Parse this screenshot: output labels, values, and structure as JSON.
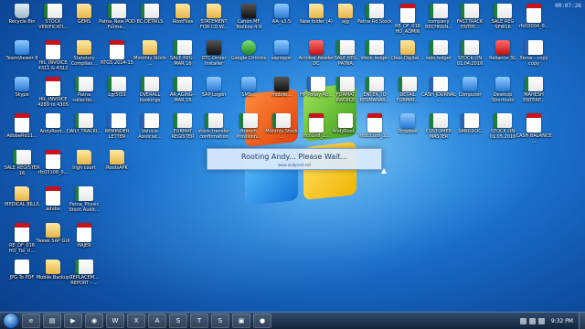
{
  "desktop_icons": [
    {
      "label": "Recycle Bin",
      "icon": "recycle-bin-icon",
      "kind": "g-bin"
    },
    {
      "label": "TeamViewer 8",
      "icon": "teamviewer-icon",
      "kind": "g-blue"
    },
    {
      "label": "Skype",
      "icon": "skype-icon",
      "kind": "g-blue"
    },
    {
      "label": "AdobeRd11...",
      "icon": "pdf-file-icon",
      "kind": "g-pdf"
    },
    {
      "label": "SALE REGISTER 16",
      "icon": "excel-file-icon",
      "kind": "g-excel"
    },
    {
      "label": "MEDICAL BILLS",
      "icon": "folder-icon",
      "kind": "g-folder"
    },
    {
      "label": "RE_DF_016 HO_Tie_U...",
      "icon": "pdf-file-icon",
      "kind": "g-pdf"
    },
    {
      "label": "JPG To PDF",
      "icon": "image-file-icon",
      "kind": "g-doc"
    },
    {
      "label": "STOCK VERIFICATI...",
      "icon": "excel-file-icon",
      "kind": "g-excel"
    },
    {
      "label": "HIL_INVOICE 4311 & 4312",
      "icon": "pdf-file-icon",
      "kind": "g-pdf"
    },
    {
      "label": "HIL_INVOICE 4289 to 4305",
      "icon": "pdf-file-icon",
      "kind": "g-pdf"
    },
    {
      "label": "AndyRoot...",
      "icon": "archive-file-icon",
      "kind": "g-doc"
    },
    {
      "label": "rfc03108_0...",
      "icon": "pdf-file-icon",
      "kind": "g-pdf"
    },
    {
      "label": "adobe",
      "icon": "pdf-file-icon",
      "kind": "g-pdf"
    },
    {
      "label": "Tweak SAP GUI",
      "icon": "folder-icon",
      "kind": "g-folder"
    },
    {
      "label": "Mobile Backup",
      "icon": "folder-icon",
      "kind": "g-folder"
    },
    {
      "label": "GEMS",
      "icon": "folder-icon",
      "kind": "g-folder"
    },
    {
      "label": "Statutory Complian...",
      "icon": "folder-icon",
      "kind": "g-folder"
    },
    {
      "label": "Patna collectio...",
      "icon": "excel-file-icon",
      "kind": "g-excel"
    },
    {
      "label": "DAILY TRACKI...",
      "icon": "excel-file-icon",
      "kind": "g-excel"
    },
    {
      "label": "high court",
      "icon": "folder-icon",
      "kind": "g-folder"
    },
    {
      "label": "Patna_Physic Stock Audit...",
      "icon": "excel-file-icon",
      "kind": "g-excel"
    },
    {
      "label": "HAJER",
      "icon": "pdf-file-icon",
      "kind": "g-pdf"
    },
    {
      "label": "REPLACEM... REPORT - ...",
      "icon": "excel-file-icon",
      "kind": "g-excel"
    },
    {
      "label": "Patna_New POD Forma...",
      "icon": "excel-file-icon",
      "kind": "g-excel"
    },
    {
      "label": "BC DETAILS",
      "icon": "excel-file-icon",
      "kind": "g-excel"
    },
    {
      "label": "RootFiles",
      "icon": "folder-icon",
      "kind": "g-folder"
    },
    {
      "label": "STATEMENT FOR CD W...",
      "icon": "folder-icon",
      "kind": "g-folder"
    },
    {
      "label": "Canon MF Toolbox 4.9",
      "icon": "printer-icon",
      "kind": "g-dark"
    },
    {
      "label": "AA_v3.5",
      "icon": "app-icon",
      "kind": "g-blue"
    },
    {
      "label": "New folder (4)",
      "icon": "folder-icon",
      "kind": "g-folder"
    },
    {
      "label": "ajg",
      "icon": "folder-icon",
      "kind": "g-folder"
    },
    {
      "label": "Patna Rd Stock",
      "icon": "excel-file-icon",
      "kind": "g-excel"
    },
    {
      "label": "RE_DF_016 HO_ADMIN",
      "icon": "pdf-file-icon",
      "kind": "g-pdf"
    },
    {
      "label": "company RECHNUN...",
      "icon": "excel-file-icon",
      "kind": "g-excel"
    },
    {
      "label": "FASTTRACK ENTRY...",
      "icon": "excel-file-icon",
      "kind": "g-excel"
    },
    {
      "label": "SALE REG SPW16",
      "icon": "excel-file-icon",
      "kind": "g-excel"
    },
    {
      "label": "rfc03004_0...",
      "icon": "pdf-file-icon",
      "kind": "g-pdf"
    },
    {
      "label": "RTGS 2014-15",
      "icon": "pdf-file-icon",
      "kind": "g-pdf"
    },
    {
      "label": "Monthly Stock ...",
      "icon": "folder-icon",
      "kind": "g-folder"
    },
    {
      "label": "SALE REG - MAR 16",
      "icon": "excel-file-icon",
      "kind": "g-excel"
    },
    {
      "label": "DTC Driver Installer",
      "icon": "app-icon",
      "kind": "g-dark"
    },
    {
      "label": "Google Chrome",
      "icon": "chrome-icon",
      "kind": "g-green"
    },
    {
      "label": "saplogon",
      "icon": "sap-icon",
      "kind": "g-blue"
    },
    {
      "label": "Acrobat Reader DC",
      "icon": "acrobat-icon",
      "kind": "g-red"
    },
    {
      "label": "SALE REG PATNA",
      "icon": "excel-file-icon",
      "kind": "g-excel"
    },
    {
      "label": "stock ledger",
      "icon": "excel-file-icon",
      "kind": "g-excel"
    },
    {
      "label": "Clear Digital ...",
      "icon": "folder-icon",
      "kind": "g-folder"
    },
    {
      "label": "sale ledger",
      "icon": "excel-file-icon",
      "kind": "g-excel"
    },
    {
      "label": "STOCK ON 01.04.2016",
      "icon": "excel-file-icon",
      "kind": "g-excel"
    },
    {
      "label": "Reliance 3G",
      "icon": "app-icon",
      "kind": "g-red"
    },
    {
      "label": "Xerox - copy copy",
      "icon": "word-file-icon",
      "kind": "g-word"
    },
    {
      "label": "Lgr5f33",
      "icon": "excel-file-icon",
      "kind": "g-excel"
    },
    {
      "label": "OVERALL bookings",
      "icon": "excel-file-icon",
      "kind": "g-excel"
    },
    {
      "label": "AR AGING - MAR 16",
      "icon": "excel-file-icon",
      "kind": "g-excel"
    },
    {
      "label": "SAP Logon",
      "icon": "sap-icon",
      "kind": "g-blue"
    },
    {
      "label": "SMS...",
      "icon": "app-icon",
      "kind": "g-blue"
    },
    {
      "label": "mobile...",
      "icon": "app-icon",
      "kind": "g-dark"
    },
    {
      "label": "HP Pollay Ap...",
      "icon": "word-file-icon",
      "kind": "g-word"
    },
    {
      "label": "FORMAT INVOICE",
      "icon": "excel-file-icon",
      "kind": "g-excel"
    },
    {
      "label": "ENTER TO RESMANAR...",
      "icon": "excel-file-icon",
      "kind": "g-excel"
    },
    {
      "label": "DETAIL FORMAT...",
      "icon": "excel-file-icon",
      "kind": "g-excel"
    },
    {
      "label": "CASH JOURNAL ...",
      "icon": "word-file-icon",
      "kind": "g-word"
    },
    {
      "label": "Computer",
      "icon": "computer-icon",
      "kind": "g-blue"
    },
    {
      "label": "Desktop Shortcuts",
      "icon": "app-icon",
      "kind": "g-blue"
    },
    {
      "label": "MAHESH ENTERP...",
      "icon": "excel-file-icon",
      "kind": "g-excel"
    },
    {
      "label": "REMINDER LETTER",
      "icon": "word-file-icon",
      "kind": "g-word"
    },
    {
      "label": "Vehicle Associat...",
      "icon": "word-file-icon",
      "kind": "g-word"
    },
    {
      "label": "FORMAT REGISTER",
      "icon": "excel-file-icon",
      "kind": "g-excel"
    },
    {
      "label": "stock transfer confirmation",
      "icon": "excel-file-icon",
      "kind": "g-excel"
    },
    {
      "label": "Branch Provision...",
      "icon": "excel-file-icon",
      "kind": "g-excel"
    },
    {
      "label": "Monthly Stock ...",
      "icon": "excel-file-icon",
      "kind": "g-excel"
    },
    {
      "label": "rfc0108_1...",
      "icon": "pdf-file-icon",
      "kind": "g-pdf"
    },
    {
      "label": "AndyRoot...",
      "icon": "archive-file-icon",
      "kind": "g-doc"
    },
    {
      "label": "rfc03108_1...",
      "icon": "pdf-file-icon",
      "kind": "g-pdf"
    },
    {
      "label": "Dropbox",
      "icon": "dropbox-icon",
      "kind": "g-blue"
    },
    {
      "label": "CUSTOMER MASTER",
      "icon": "excel-file-icon",
      "kind": "g-excel"
    },
    {
      "label": "SANDDOC",
      "icon": "word-file-icon",
      "kind": "g-word"
    },
    {
      "label": "STOCK ON 01.05.2016",
      "icon": "excel-file-icon",
      "kind": "g-excel"
    },
    {
      "label": "CASH BALANCE ...",
      "icon": "pdf-file-icon",
      "kind": "g-pdf"
    },
    {
      "label": "RootsAPK",
      "icon": "folder-icon",
      "kind": "g-folder"
    }
  ],
  "dialog": {
    "text": "Rooting Andy... Please Wait...",
    "subtext": "www.andyroid.net"
  },
  "recording_timer": "00:07:26",
  "taskbar": {
    "clock": "9:32 PM",
    "buttons": [
      {
        "icon": "ie-icon",
        "glyph": "e"
      },
      {
        "icon": "explorer-icon",
        "glyph": "▤"
      },
      {
        "icon": "media-player-icon",
        "glyph": "▶"
      },
      {
        "icon": "chrome-icon",
        "glyph": "◉"
      },
      {
        "icon": "word-icon",
        "glyph": "W"
      },
      {
        "icon": "excel-icon",
        "glyph": "X"
      },
      {
        "icon": "acrobat-icon",
        "glyph": "A"
      },
      {
        "icon": "skype-icon",
        "glyph": "S"
      },
      {
        "icon": "teamviewer-icon",
        "glyph": "T"
      },
      {
        "icon": "sap-icon",
        "glyph": "S"
      },
      {
        "icon": "andy-icon",
        "glyph": "▣"
      },
      {
        "icon": "recorder-icon",
        "glyph": "●"
      }
    ]
  }
}
